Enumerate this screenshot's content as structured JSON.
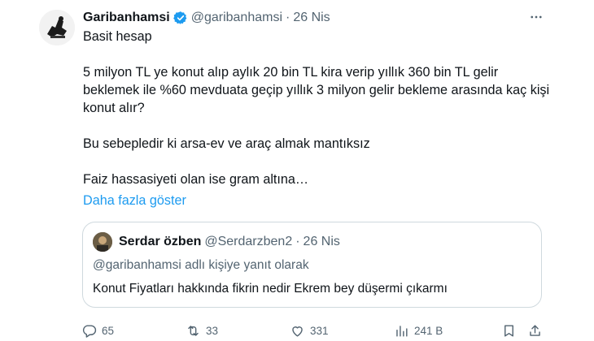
{
  "tweet": {
    "author_name": "Garibanhamsi",
    "author_handle": "@garibanhamsi",
    "separator": "·",
    "time": "26 Nis",
    "lines": [
      "Basit hesap",
      "5 milyon TL ye konut alıp aylık 20 bin TL kira verip yıllık 360 bin TL gelir beklemek ile %60 mevduata geçip yıllık 3 milyon gelir bekleme arasında kaç kişi konut alır?",
      "Bu sebepledir ki arsa-ev ve araç almak mantıksız",
      "Faiz hassasiyeti olan ise gram altına…"
    ],
    "show_more": "Daha fazla göster"
  },
  "quote": {
    "author_name": "Serdar özben",
    "author_handle": "@Serdarzben2",
    "separator": "·",
    "time": "26 Nis",
    "reply_context": "@garibanhamsi adlı kişiye yanıt olarak",
    "text": "Konut Fiyatları hakkında fikrin nedir Ekrem bey düşermi çıkarmı"
  },
  "actions": {
    "replies": "65",
    "retweets": "33",
    "likes": "331",
    "views": "241 B"
  },
  "icons": [
    "verified-badge-icon",
    "more-icon",
    "reply-icon",
    "retweet-icon",
    "like-icon",
    "views-icon",
    "bookmark-icon",
    "share-icon"
  ],
  "colors": {
    "link": "#1d9bf0",
    "muted": "#536471",
    "text": "#0f1419",
    "border": "#cfd9de"
  }
}
